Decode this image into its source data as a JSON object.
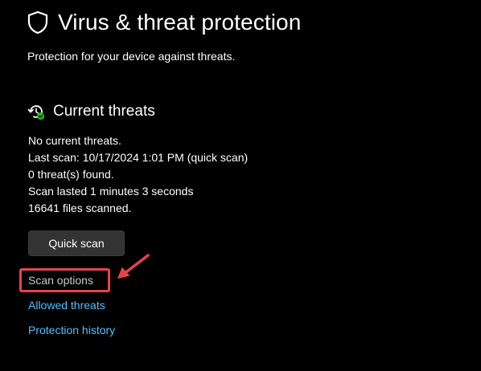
{
  "header": {
    "title": "Virus & threat protection",
    "subtitle": "Protection for your device against threats."
  },
  "current_threats": {
    "title": "Current threats",
    "lines": [
      "No current threats.",
      "Last scan: 10/17/2024 1:01 PM (quick scan)",
      "0 threat(s) found.",
      "Scan lasted 1 minutes 3 seconds",
      "16641 files scanned."
    ],
    "quick_scan_label": "Quick scan",
    "scan_options_label": "Scan options"
  },
  "links": {
    "allowed_threats": "Allowed threats",
    "protection_history": "Protection history"
  },
  "colors": {
    "background": "#000000",
    "text": "#ffffff",
    "link": "#4cc2ff",
    "button_bg": "#333333",
    "annotation": "#e8434b",
    "status_ok": "#16c60c"
  },
  "icons": {
    "header": "shield-icon",
    "section": "refresh-check-icon",
    "annotation": "arrow-icon"
  }
}
